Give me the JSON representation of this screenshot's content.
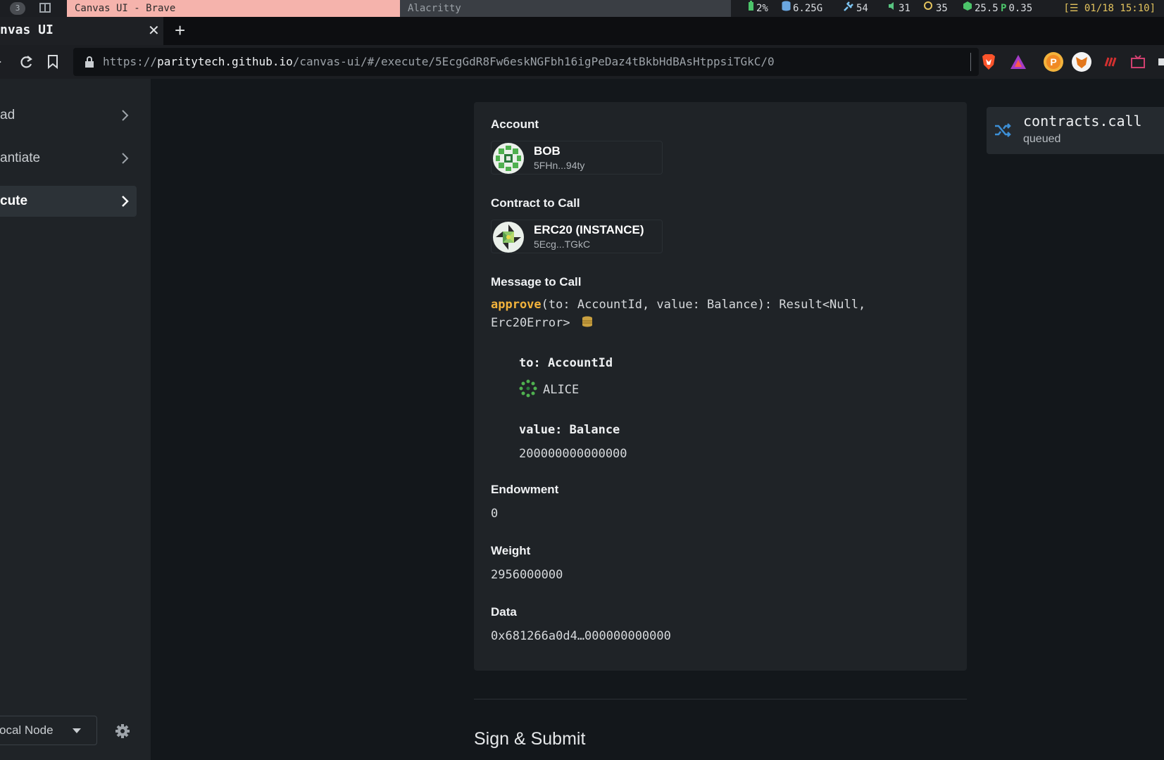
{
  "os_bar": {
    "workspace": "3",
    "active_window_title": "Canvas UI - Brave",
    "inactive_window_title": "Alacritty",
    "battery": "2%",
    "memory": "6.25G",
    "updates": "54",
    "volume": "31",
    "brightness": "35",
    "cpu_temp": "25.5",
    "power": "0.35",
    "clock": "01/18 15:10"
  },
  "browser": {
    "tab_title": "nvas UI",
    "url_scheme": "https://",
    "url_host": "paritytech.github.io",
    "url_path": "/canvas-ui/#/execute/5EcgGdR8Fw6eskNGFbh16igPeDaz4tBkbHdBAsHtppsiTGkC/0"
  },
  "sidebar": {
    "items": [
      {
        "label": "ad"
      },
      {
        "label": "antiate"
      },
      {
        "label": "cute"
      }
    ],
    "node_select": "ocal Node"
  },
  "form": {
    "account_label": "Account",
    "account": {
      "name": "BOB",
      "address": "5FHn...94ty"
    },
    "contract_label": "Contract to Call",
    "contract": {
      "name": "ERC20 (INSTANCE)",
      "address": "5Ecg...TGkC"
    },
    "message_label": "Message to Call",
    "message_fn": "approve",
    "message_sig_line1": "(to: AccountId, value: Balance): Result<Null,",
    "message_sig_line2": "Erc20Error>",
    "args": [
      {
        "name": "to: AccountId",
        "value": "ALICE"
      },
      {
        "name": "value: Balance",
        "value": "200000000000000"
      }
    ],
    "endowment_label": "Endowment",
    "endowment": "0",
    "weight_label": "Weight",
    "weight": "2956000000",
    "data_label": "Data",
    "data": "0x681266a0d4…000000000000",
    "sign_title": "Sign & Submit"
  },
  "toast": {
    "title": "contracts.call",
    "status": "queued"
  },
  "colors": {
    "accent_orange": "#f3b33c",
    "toast_icon": "#3d8fd6",
    "brave_lion": "#fb542b"
  }
}
